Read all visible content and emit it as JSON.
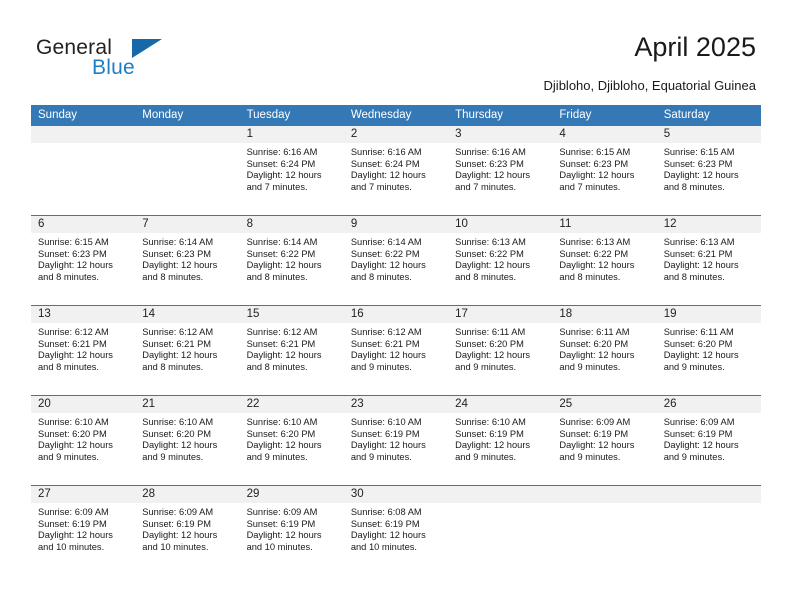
{
  "brand": {
    "name_part1": "General",
    "name_part2": "Blue",
    "triangle_color": "#1668a8",
    "blue_text_color": "#1f7fc4"
  },
  "header": {
    "title": "April 2025",
    "location": "Djibloho, Djibloho, Equatorial Guinea"
  },
  "calendar": {
    "header_color": "#3479b5",
    "weekdays": [
      "Sunday",
      "Monday",
      "Tuesday",
      "Wednesday",
      "Thursday",
      "Friday",
      "Saturday"
    ],
    "weeks": [
      [
        {
          "day": "",
          "sunrise": "",
          "sunset": "",
          "daylight": "",
          "empty": true
        },
        {
          "day": "",
          "sunrise": "",
          "sunset": "",
          "daylight": "",
          "empty": true
        },
        {
          "day": "1",
          "sunrise": "Sunrise: 6:16 AM",
          "sunset": "Sunset: 6:24 PM",
          "daylight": "Daylight: 12 hours and 7 minutes."
        },
        {
          "day": "2",
          "sunrise": "Sunrise: 6:16 AM",
          "sunset": "Sunset: 6:24 PM",
          "daylight": "Daylight: 12 hours and 7 minutes."
        },
        {
          "day": "3",
          "sunrise": "Sunrise: 6:16 AM",
          "sunset": "Sunset: 6:23 PM",
          "daylight": "Daylight: 12 hours and 7 minutes."
        },
        {
          "day": "4",
          "sunrise": "Sunrise: 6:15 AM",
          "sunset": "Sunset: 6:23 PM",
          "daylight": "Daylight: 12 hours and 7 minutes."
        },
        {
          "day": "5",
          "sunrise": "Sunrise: 6:15 AM",
          "sunset": "Sunset: 6:23 PM",
          "daylight": "Daylight: 12 hours and 8 minutes."
        }
      ],
      [
        {
          "day": "6",
          "sunrise": "Sunrise: 6:15 AM",
          "sunset": "Sunset: 6:23 PM",
          "daylight": "Daylight: 12 hours and 8 minutes."
        },
        {
          "day": "7",
          "sunrise": "Sunrise: 6:14 AM",
          "sunset": "Sunset: 6:23 PM",
          "daylight": "Daylight: 12 hours and 8 minutes."
        },
        {
          "day": "8",
          "sunrise": "Sunrise: 6:14 AM",
          "sunset": "Sunset: 6:22 PM",
          "daylight": "Daylight: 12 hours and 8 minutes."
        },
        {
          "day": "9",
          "sunrise": "Sunrise: 6:14 AM",
          "sunset": "Sunset: 6:22 PM",
          "daylight": "Daylight: 12 hours and 8 minutes."
        },
        {
          "day": "10",
          "sunrise": "Sunrise: 6:13 AM",
          "sunset": "Sunset: 6:22 PM",
          "daylight": "Daylight: 12 hours and 8 minutes."
        },
        {
          "day": "11",
          "sunrise": "Sunrise: 6:13 AM",
          "sunset": "Sunset: 6:22 PM",
          "daylight": "Daylight: 12 hours and 8 minutes."
        },
        {
          "day": "12",
          "sunrise": "Sunrise: 6:13 AM",
          "sunset": "Sunset: 6:21 PM",
          "daylight": "Daylight: 12 hours and 8 minutes."
        }
      ],
      [
        {
          "day": "13",
          "sunrise": "Sunrise: 6:12 AM",
          "sunset": "Sunset: 6:21 PM",
          "daylight": "Daylight: 12 hours and 8 minutes."
        },
        {
          "day": "14",
          "sunrise": "Sunrise: 6:12 AM",
          "sunset": "Sunset: 6:21 PM",
          "daylight": "Daylight: 12 hours and 8 minutes."
        },
        {
          "day": "15",
          "sunrise": "Sunrise: 6:12 AM",
          "sunset": "Sunset: 6:21 PM",
          "daylight": "Daylight: 12 hours and 8 minutes."
        },
        {
          "day": "16",
          "sunrise": "Sunrise: 6:12 AM",
          "sunset": "Sunset: 6:21 PM",
          "daylight": "Daylight: 12 hours and 9 minutes."
        },
        {
          "day": "17",
          "sunrise": "Sunrise: 6:11 AM",
          "sunset": "Sunset: 6:20 PM",
          "daylight": "Daylight: 12 hours and 9 minutes."
        },
        {
          "day": "18",
          "sunrise": "Sunrise: 6:11 AM",
          "sunset": "Sunset: 6:20 PM",
          "daylight": "Daylight: 12 hours and 9 minutes."
        },
        {
          "day": "19",
          "sunrise": "Sunrise: 6:11 AM",
          "sunset": "Sunset: 6:20 PM",
          "daylight": "Daylight: 12 hours and 9 minutes."
        }
      ],
      [
        {
          "day": "20",
          "sunrise": "Sunrise: 6:10 AM",
          "sunset": "Sunset: 6:20 PM",
          "daylight": "Daylight: 12 hours and 9 minutes."
        },
        {
          "day": "21",
          "sunrise": "Sunrise: 6:10 AM",
          "sunset": "Sunset: 6:20 PM",
          "daylight": "Daylight: 12 hours and 9 minutes."
        },
        {
          "day": "22",
          "sunrise": "Sunrise: 6:10 AM",
          "sunset": "Sunset: 6:20 PM",
          "daylight": "Daylight: 12 hours and 9 minutes."
        },
        {
          "day": "23",
          "sunrise": "Sunrise: 6:10 AM",
          "sunset": "Sunset: 6:19 PM",
          "daylight": "Daylight: 12 hours and 9 minutes."
        },
        {
          "day": "24",
          "sunrise": "Sunrise: 6:10 AM",
          "sunset": "Sunset: 6:19 PM",
          "daylight": "Daylight: 12 hours and 9 minutes."
        },
        {
          "day": "25",
          "sunrise": "Sunrise: 6:09 AM",
          "sunset": "Sunset: 6:19 PM",
          "daylight": "Daylight: 12 hours and 9 minutes."
        },
        {
          "day": "26",
          "sunrise": "Sunrise: 6:09 AM",
          "sunset": "Sunset: 6:19 PM",
          "daylight": "Daylight: 12 hours and 9 minutes."
        }
      ],
      [
        {
          "day": "27",
          "sunrise": "Sunrise: 6:09 AM",
          "sunset": "Sunset: 6:19 PM",
          "daylight": "Daylight: 12 hours and 10 minutes."
        },
        {
          "day": "28",
          "sunrise": "Sunrise: 6:09 AM",
          "sunset": "Sunset: 6:19 PM",
          "daylight": "Daylight: 12 hours and 10 minutes."
        },
        {
          "day": "29",
          "sunrise": "Sunrise: 6:09 AM",
          "sunset": "Sunset: 6:19 PM",
          "daylight": "Daylight: 12 hours and 10 minutes."
        },
        {
          "day": "30",
          "sunrise": "Sunrise: 6:08 AM",
          "sunset": "Sunset: 6:19 PM",
          "daylight": "Daylight: 12 hours and 10 minutes."
        },
        {
          "day": "",
          "sunrise": "",
          "sunset": "",
          "daylight": "",
          "empty": true
        },
        {
          "day": "",
          "sunrise": "",
          "sunset": "",
          "daylight": "",
          "empty": true
        },
        {
          "day": "",
          "sunrise": "",
          "sunset": "",
          "daylight": "",
          "empty": true
        }
      ]
    ]
  }
}
